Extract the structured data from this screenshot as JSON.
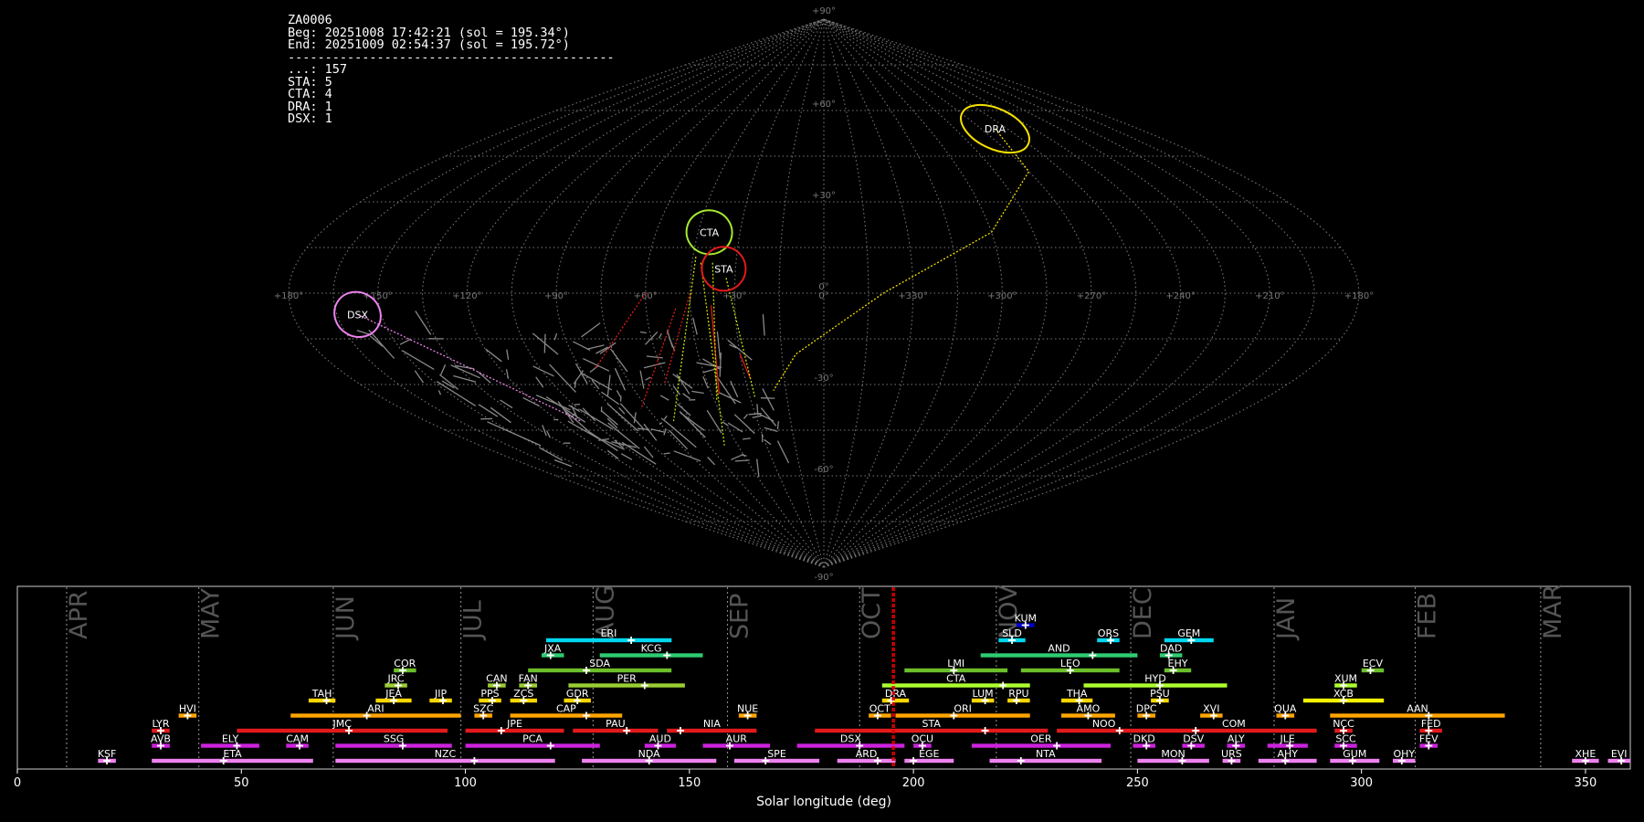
{
  "info": {
    "id": "ZA0006",
    "beg": "Beg: 20251008 17:42:21 (sol = 195.34°)",
    "end": "End: 20251009 02:54:37 (sol = 195.72°)",
    "rule": "--------------------------------------------",
    "counts": [
      {
        "label": "...: 157",
        "code": "...",
        "n": 157
      },
      {
        "label": "STA: 5",
        "code": "STA",
        "n": 5
      },
      {
        "label": "CTA: 4",
        "code": "CTA",
        "n": 4
      },
      {
        "label": "DRA: 1",
        "code": "DRA",
        "n": 1
      },
      {
        "label": "DSX: 1",
        "code": "DSX",
        "n": 1
      }
    ]
  },
  "sky_map": {
    "projection": "sinusoidal",
    "lat_labels": [
      "+90°",
      "+60°",
      "+30°",
      "0°",
      "-30°",
      "-60°",
      "-90°"
    ],
    "lon_labels": [
      "+180°",
      "+150°",
      "+120°",
      "+90°",
      "+60°",
      "+30°",
      "0°",
      "+330°",
      "+300°",
      "+270°",
      "+240°",
      "+210°",
      "+180°"
    ],
    "radiants": [
      {
        "code": "DRA",
        "ra": 262,
        "dec": 54,
        "color": "#f5e000"
      },
      {
        "code": "CTA",
        "ra": 41,
        "dec": 20,
        "color": "#a6e830"
      },
      {
        "code": "STA",
        "ra": 34,
        "dec": 8,
        "color": "#e31a1c"
      },
      {
        "code": "DSX",
        "ra": 158,
        "dec": -7,
        "color": "#ee82ee"
      }
    ]
  },
  "chart_data": {
    "type": "timeline",
    "xlabel": "Solar longitude (deg)",
    "xlim": [
      0,
      360
    ],
    "xticks": [
      0,
      50,
      100,
      150,
      200,
      250,
      300,
      350
    ],
    "current_sol": [
      195.34,
      195.72
    ],
    "months": [
      {
        "name": "APR",
        "start": 11
      },
      {
        "name": "MAY",
        "start": 40.5
      },
      {
        "name": "JUN",
        "start": 70.5
      },
      {
        "name": "JUL",
        "start": 99
      },
      {
        "name": "AUG",
        "start": 128.5
      },
      {
        "name": "SEP",
        "start": 158.5
      },
      {
        "name": "OCT",
        "start": 188
      },
      {
        "name": "NOV",
        "start": 218.5
      },
      {
        "name": "DEC",
        "start": 248.5
      },
      {
        "name": "JAN",
        "start": 280.5
      },
      {
        "name": "FEB",
        "start": 312
      },
      {
        "name": "MAR",
        "start": 340
      }
    ],
    "showers": [
      {
        "code": "KSF",
        "row": 0,
        "start": 18,
        "end": 22,
        "peak": 20,
        "color": "#ee82ee"
      },
      {
        "code": "ETA",
        "row": 0,
        "start": 30,
        "end": 66,
        "peak": 46,
        "color": "#ee82ee"
      },
      {
        "code": "NZC",
        "row": 0,
        "start": 71,
        "end": 120,
        "peak": 102,
        "color": "#ee82ee"
      },
      {
        "code": "NDA",
        "row": 0,
        "start": 126,
        "end": 156,
        "peak": 141,
        "color": "#ee82ee"
      },
      {
        "code": "SPE",
        "row": 0,
        "start": 160,
        "end": 179,
        "peak": 167,
        "color": "#ee82ee"
      },
      {
        "code": "ARD",
        "row": 0,
        "start": 183,
        "end": 196,
        "peak": 192,
        "color": "#ee82ee"
      },
      {
        "code": "EGE",
        "row": 0,
        "start": 198,
        "end": 209,
        "peak": 200,
        "color": "#ee82ee"
      },
      {
        "code": "NTA",
        "row": 0,
        "start": 217,
        "end": 242,
        "peak": 224,
        "color": "#ee82ee"
      },
      {
        "code": "MON",
        "row": 0,
        "start": 250,
        "end": 266,
        "peak": 260,
        "color": "#ee82ee"
      },
      {
        "code": "URS",
        "row": 0,
        "start": 269,
        "end": 273,
        "peak": 271,
        "color": "#ee82ee"
      },
      {
        "code": "AHY",
        "row": 0,
        "start": 277,
        "end": 290,
        "peak": 283,
        "color": "#ee82ee"
      },
      {
        "code": "GUM",
        "row": 0,
        "start": 293,
        "end": 304,
        "peak": 298,
        "color": "#ee82ee"
      },
      {
        "code": "OHY",
        "row": 0,
        "start": 307,
        "end": 312,
        "peak": 309,
        "color": "#ee82ee"
      },
      {
        "code": "XHE",
        "row": 0,
        "start": 347,
        "end": 353,
        "peak": 350,
        "color": "#ee82ee"
      },
      {
        "code": "EVI",
        "row": 0,
        "start": 355,
        "end": 360,
        "peak": 358,
        "color": "#ee82ee"
      },
      {
        "code": "AVB",
        "row": 1,
        "start": 30,
        "end": 34,
        "peak": 32,
        "color": "#cc22dd"
      },
      {
        "code": "ELY",
        "row": 1,
        "start": 41,
        "end": 54,
        "peak": 49,
        "color": "#cc22dd"
      },
      {
        "code": "CAM",
        "row": 1,
        "start": 60,
        "end": 65,
        "peak": 63,
        "color": "#cc22dd"
      },
      {
        "code": "SSG",
        "row": 1,
        "start": 71,
        "end": 97,
        "peak": 86,
        "color": "#cc22dd"
      },
      {
        "code": "PCA",
        "row": 1,
        "start": 100,
        "end": 130,
        "peak": 119,
        "color": "#cc22dd"
      },
      {
        "code": "AUD",
        "row": 1,
        "start": 140,
        "end": 147,
        "peak": 143,
        "color": "#cc22dd"
      },
      {
        "code": "AUR",
        "row": 1,
        "start": 153,
        "end": 168,
        "peak": 159,
        "color": "#cc22dd"
      },
      {
        "code": "DSX",
        "row": 1,
        "start": 174,
        "end": 198,
        "peak": 188,
        "color": "#cc22dd"
      },
      {
        "code": "OCU",
        "row": 1,
        "start": 200,
        "end": 204,
        "peak": 202,
        "color": "#cc22dd"
      },
      {
        "code": "OER",
        "row": 1,
        "start": 213,
        "end": 244,
        "peak": 232,
        "color": "#cc22dd"
      },
      {
        "code": "DKD",
        "row": 1,
        "start": 249,
        "end": 254,
        "peak": 252,
        "color": "#cc22dd"
      },
      {
        "code": "DSV",
        "row": 1,
        "start": 260,
        "end": 265,
        "peak": 262,
        "color": "#cc22dd"
      },
      {
        "code": "ALY",
        "row": 1,
        "start": 270,
        "end": 274,
        "peak": 272,
        "color": "#cc22dd"
      },
      {
        "code": "JLE",
        "row": 1,
        "start": 279,
        "end": 288,
        "peak": 284,
        "color": "#cc22dd"
      },
      {
        "code": "SCC",
        "row": 1,
        "start": 294,
        "end": 299,
        "peak": 296,
        "color": "#cc22dd"
      },
      {
        "code": "FEV",
        "row": 1,
        "start": 313,
        "end": 317,
        "peak": 315,
        "color": "#cc22dd"
      },
      {
        "code": "LYR",
        "row": 2,
        "start": 30,
        "end": 34,
        "peak": 32,
        "color": "#e31a1c"
      },
      {
        "code": "JMC",
        "row": 2,
        "start": 49,
        "end": 96,
        "peak": 74,
        "color": "#e31a1c"
      },
      {
        "code": "JPE",
        "row": 2,
        "start": 100,
        "end": 122,
        "peak": 108,
        "color": "#e31a1c"
      },
      {
        "code": "PAU",
        "row": 2,
        "start": 124,
        "end": 143,
        "peak": 136,
        "color": "#e31a1c"
      },
      {
        "code": "NIA",
        "row": 2,
        "start": 145,
        "end": 165,
        "peak": 148,
        "color": "#e31a1c"
      },
      {
        "code": "STA",
        "row": 2,
        "start": 178,
        "end": 230,
        "peak": 216,
        "color": "#e31a1c"
      },
      {
        "code": "NOO",
        "row": 2,
        "start": 232,
        "end": 253,
        "peak": 246,
        "color": "#e31a1c"
      },
      {
        "code": "COM",
        "row": 2,
        "start": 253,
        "end": 290,
        "peak": 263,
        "color": "#e31a1c"
      },
      {
        "code": "NCC",
        "row": 2,
        "start": 294,
        "end": 298,
        "peak": 296,
        "color": "#e31a1c"
      },
      {
        "code": "FED",
        "row": 2,
        "start": 313,
        "end": 318,
        "peak": 315,
        "color": "#e31a1c"
      },
      {
        "code": "HVI",
        "row": 3,
        "start": 36,
        "end": 40,
        "peak": 38,
        "color": "#ffa500"
      },
      {
        "code": "ARI",
        "row": 3,
        "start": 61,
        "end": 99,
        "peak": 78,
        "color": "#ffa500"
      },
      {
        "code": "SZC",
        "row": 3,
        "start": 102,
        "end": 106,
        "peak": 104,
        "color": "#ffa500"
      },
      {
        "code": "CAP",
        "row": 3,
        "start": 110,
        "end": 135,
        "peak": 127,
        "color": "#ffa500"
      },
      {
        "code": "NUE",
        "row": 3,
        "start": 161,
        "end": 165,
        "peak": 163,
        "color": "#ffa500"
      },
      {
        "code": "OCT",
        "row": 3,
        "start": 190,
        "end": 195,
        "peak": 192,
        "color": "#ffa500"
      },
      {
        "code": "ORI",
        "row": 3,
        "start": 196,
        "end": 226,
        "peak": 209,
        "color": "#ffa500"
      },
      {
        "code": "AMO",
        "row": 3,
        "start": 233,
        "end": 245,
        "peak": 239,
        "color": "#ffa500"
      },
      {
        "code": "DPC",
        "row": 3,
        "start": 250,
        "end": 254,
        "peak": 252,
        "color": "#ffa500"
      },
      {
        "code": "XVI",
        "row": 3,
        "start": 264,
        "end": 269,
        "peak": 267,
        "color": "#ffa500"
      },
      {
        "code": "QUA",
        "row": 3,
        "start": 281,
        "end": 285,
        "peak": 283,
        "color": "#ffa500"
      },
      {
        "code": "AAN",
        "row": 3,
        "start": 293,
        "end": 332,
        "peak": 315,
        "color": "#ffa500"
      },
      {
        "code": "TAH",
        "row": 4,
        "start": 65,
        "end": 71,
        "peak": 69,
        "color": "#ffd700"
      },
      {
        "code": "JEA",
        "row": 4,
        "start": 80,
        "end": 88,
        "peak": 84,
        "color": "#ffd700"
      },
      {
        "code": "JIP",
        "row": 4,
        "start": 92,
        "end": 97,
        "peak": 95,
        "color": "#ffd700"
      },
      {
        "code": "PPS",
        "row": 4,
        "start": 103,
        "end": 108,
        "peak": 106,
        "color": "#ffd700"
      },
      {
        "code": "ZCS",
        "row": 4,
        "start": 110,
        "end": 116,
        "peak": 113,
        "color": "#ffd700"
      },
      {
        "code": "GDR",
        "row": 4,
        "start": 122,
        "end": 128,
        "peak": 125,
        "color": "#ffd700"
      },
      {
        "code": "DRA",
        "row": 4,
        "start": 193,
        "end": 199,
        "peak": 195,
        "color": "#ffd700"
      },
      {
        "code": "LUM",
        "row": 4,
        "start": 213,
        "end": 218,
        "peak": 216,
        "color": "#ffd700"
      },
      {
        "code": "RPU",
        "row": 4,
        "start": 221,
        "end": 226,
        "peak": 223,
        "color": "#ffd700"
      },
      {
        "code": "THA",
        "row": 4,
        "start": 233,
        "end": 240,
        "peak": 237,
        "color": "#ffd700"
      },
      {
        "code": "PSU",
        "row": 4,
        "start": 253,
        "end": 257,
        "peak": 255,
        "color": "#ffd700"
      },
      {
        "code": "XCB",
        "row": 4,
        "start": 287,
        "end": 305,
        "peak": 296,
        "color": "#f5f500"
      },
      {
        "code": "JRC",
        "row": 5,
        "start": 82,
        "end": 87,
        "peak": 85,
        "color": "#9acd32"
      },
      {
        "code": "CAN",
        "row": 5,
        "start": 105,
        "end": 109,
        "peak": 107,
        "color": "#9acd32"
      },
      {
        "code": "FAN",
        "row": 5,
        "start": 112,
        "end": 116,
        "peak": 114,
        "color": "#9acd32"
      },
      {
        "code": "PER",
        "row": 5,
        "start": 123,
        "end": 149,
        "peak": 140,
        "color": "#9acd32"
      },
      {
        "code": "CTA",
        "row": 5,
        "start": 193,
        "end": 226,
        "peak": 220,
        "color": "#adff2f"
      },
      {
        "code": "HYD",
        "row": 5,
        "start": 238,
        "end": 270,
        "peak": 255,
        "color": "#adff2f"
      },
      {
        "code": "XUM",
        "row": 5,
        "start": 294,
        "end": 299,
        "peak": 296,
        "color": "#adff2f"
      },
      {
        "code": "COR",
        "row": 6,
        "start": 84,
        "end": 89,
        "peak": 86,
        "color": "#6bbf2a"
      },
      {
        "code": "SDA",
        "row": 6,
        "start": 114,
        "end": 146,
        "peak": 127,
        "color": "#6bbf2a"
      },
      {
        "code": "LMI",
        "row": 6,
        "start": 198,
        "end": 221,
        "peak": 209,
        "color": "#6bbf2a"
      },
      {
        "code": "LEO",
        "row": 6,
        "start": 224,
        "end": 246,
        "peak": 235,
        "color": "#6bbf2a"
      },
      {
        "code": "EHY",
        "row": 6,
        "start": 256,
        "end": 262,
        "peak": 258,
        "color": "#6bbf2a"
      },
      {
        "code": "ECV",
        "row": 6,
        "start": 300,
        "end": 305,
        "peak": 302,
        "color": "#6bbf2a"
      },
      {
        "code": "JXA",
        "row": 7,
        "start": 117,
        "end": 122,
        "peak": 119,
        "color": "#2ecc71"
      },
      {
        "code": "KCG",
        "row": 7,
        "start": 130,
        "end": 153,
        "peak": 145,
        "color": "#2ecc71"
      },
      {
        "code": "AND",
        "row": 7,
        "start": 215,
        "end": 250,
        "peak": 240,
        "color": "#2ecc71"
      },
      {
        "code": "DAD",
        "row": 7,
        "start": 255,
        "end": 260,
        "peak": 257,
        "color": "#2ecc71"
      },
      {
        "code": "ERI",
        "row": 8,
        "start": 118,
        "end": 146,
        "peak": 137,
        "color": "#00d7f0"
      },
      {
        "code": "SLD",
        "row": 8,
        "start": 219,
        "end": 225,
        "peak": 222,
        "color": "#00d7f0"
      },
      {
        "code": "ORS",
        "row": 8,
        "start": 241,
        "end": 246,
        "peak": 244,
        "color": "#00d7f0"
      },
      {
        "code": "GEM",
        "row": 8,
        "start": 256,
        "end": 267,
        "peak": 262,
        "color": "#00d7f0"
      },
      {
        "code": "KUM",
        "row": 9,
        "start": 223,
        "end": 227,
        "peak": 225,
        "color": "#0000cd"
      }
    ]
  }
}
